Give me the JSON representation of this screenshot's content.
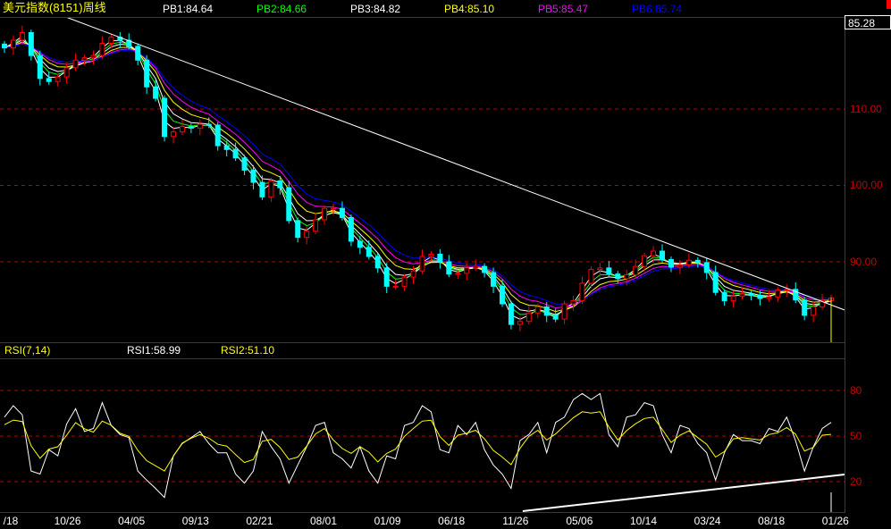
{
  "header": {
    "title": "美元指数(8151)周线",
    "pb": [
      {
        "label": "PB1:84.64",
        "color": "#ffffff"
      },
      {
        "label": "PB2:84.66",
        "color": "#00ff00"
      },
      {
        "label": "PB3:84.82",
        "color": "#ffffff"
      },
      {
        "label": "PB4:85.10",
        "color": "#ffff00"
      },
      {
        "label": "PB5:85.47",
        "color": "#ff00ff"
      },
      {
        "label": "PB6:85.74",
        "color": "#0000ff"
      }
    ]
  },
  "price_box": "85.28",
  "rsi_header": {
    "name": "RSI(7,14)",
    "rsi1": "RSI1:58.99",
    "rsi2": "RSI2:51.10"
  },
  "colors": {
    "up": "#ff0000",
    "down": "#00ffff",
    "grid": "#c00000",
    "bg": "#000000"
  },
  "chart_data": [
    {
      "type": "candlestick",
      "title": "美元指数(8151)周线",
      "ylim": [
        79.5,
        122
      ],
      "y_ticks": [
        "110.00",
        "100.00",
        "90.00"
      ],
      "y_tick_values": [
        110,
        100,
        90
      ],
      "last_price": 85.28,
      "close": [
        118,
        119,
        120,
        117,
        114,
        113.6,
        114.2,
        115.4,
        116.4,
        116.7,
        117,
        118.6,
        119.4,
        119,
        118.2,
        116.4,
        112.9,
        111.4,
        106.4,
        107,
        107.7,
        107.5,
        108,
        107.9,
        105.2,
        104.7,
        103.6,
        102,
        100.4,
        98.5,
        100.6,
        99.7,
        95.4,
        93.2,
        94,
        95.5,
        97,
        97,
        95.8,
        92.7,
        91.9,
        90.7,
        89.2,
        86.8,
        86.8,
        88,
        88.8,
        90.7,
        91,
        90,
        88.4,
        88.5,
        89.2,
        89.4,
        88.6,
        86.8,
        84.5,
        81.8,
        82.2,
        83.3,
        84.1,
        83,
        82.5,
        84.5,
        84.9,
        87.2,
        89,
        89.2,
        88.4,
        87.8,
        88.3,
        89.4,
        90.8,
        91.4,
        90.3,
        89.3,
        89.6,
        90.2,
        89.9,
        88.6,
        86,
        84.9,
        85.5,
        85.8,
        85.6,
        85.2,
        85.4,
        86.3,
        86.4,
        85,
        83,
        84.1,
        84.9,
        85.28
      ],
      "ma_series": [
        {
          "name": "PB1",
          "value": 84.64,
          "color": "#ffffff",
          "span": 2
        },
        {
          "name": "PB2",
          "value": 84.66,
          "color": "#00ff00",
          "span": 3
        },
        {
          "name": "PB3",
          "value": 84.82,
          "color": "#ffffff",
          "span": 4
        },
        {
          "name": "PB4",
          "value": 85.1,
          "color": "#ffff00",
          "span": 6
        },
        {
          "name": "PB5",
          "value": 85.47,
          "color": "#ff00ff",
          "span": 8
        },
        {
          "name": "PB6",
          "value": 85.74,
          "color": "#0000ff",
          "span": 10
        }
      ],
      "trendline": {
        "from": [
          7,
          122.0
        ],
        "to": [
          94.5,
          83.7
        ],
        "color": "#ffffff"
      }
    },
    {
      "type": "line",
      "title": "RSI(7,14)",
      "ylim": [
        0.5,
        101
      ],
      "y_ticks": [
        "80",
        "50",
        "20"
      ],
      "y_tick_values": [
        80,
        50,
        20
      ],
      "series": [
        {
          "name": "RSI1",
          "value": 58.99,
          "color": "#ffffff",
          "values": [
            62.5,
            70,
            64,
            27,
            25,
            41,
            37,
            58,
            68,
            53,
            55,
            72,
            57,
            51,
            49,
            27,
            21,
            15.5,
            9.6,
            37,
            45,
            49,
            53,
            45,
            39,
            39,
            25,
            19,
            27,
            53,
            43,
            35,
            19,
            31,
            43,
            57,
            59,
            39,
            35,
            29,
            43,
            27,
            19,
            37,
            35,
            57,
            59,
            70,
            66,
            41,
            39,
            57,
            51,
            59,
            41,
            31,
            25,
            15.5,
            47,
            51,
            59,
            39,
            59,
            62.5,
            74,
            78,
            74,
            78,
            51,
            43,
            62.5,
            64,
            72,
            70,
            51,
            39,
            57,
            55,
            45,
            39,
            21,
            39,
            51,
            47,
            47,
            45,
            55,
            53,
            62.5,
            47,
            27,
            43,
            55,
            58.99
          ]
        },
        {
          "name": "RSI2",
          "value": 51.1,
          "color": "#ffff00",
          "values": [
            57.5,
            60.5,
            59.6,
            43.6,
            35.4,
            41.4,
            43,
            50.6,
            58.8,
            54.8,
            52.6,
            59.8,
            57.2,
            51.8,
            49.8,
            40.6,
            33.8,
            30.4,
            27,
            36.7,
            45.4,
            48.6,
            51,
            48.6,
            44.6,
            43.4,
            37.8,
            32.6,
            34.6,
            46.6,
            47.8,
            42.6,
            34.6,
            36.2,
            43.4,
            51.4,
            55,
            47.4,
            41.8,
            38.6,
            43,
            39.4,
            33,
            38.6,
            41.4,
            49.8,
            55,
            59.8,
            60.4,
            49.6,
            43.8,
            50.6,
            51.8,
            53.8,
            48.2,
            40.6,
            36.2,
            31.2,
            41.9,
            49.8,
            53.8,
            47.4,
            51.4,
            56.8,
            62.1,
            66,
            65.2,
            66,
            56,
            47.4,
            53.6,
            58.1,
            61.6,
            62.4,
            54.4,
            45.8,
            50.6,
            53.4,
            49,
            44.6,
            36.2,
            39.8,
            48.2,
            49,
            48.2,
            47.4,
            51,
            52.2,
            55.6,
            51.3,
            40.2,
            42.6,
            50.6,
            51.1
          ]
        }
      ],
      "trendline": {
        "from": [
          58.3,
          0.6
        ],
        "to": [
          94.5,
          24.7
        ],
        "color": "#ffffff"
      }
    }
  ],
  "x_ticks": [
    "/18",
    "10/26",
    "04/05",
    "09/13",
    "02/21",
    "08/01",
    "01/09",
    "06/18",
    "11/26",
    "05/06",
    "10/14",
    "03/24",
    "08/18",
    "01/26"
  ]
}
